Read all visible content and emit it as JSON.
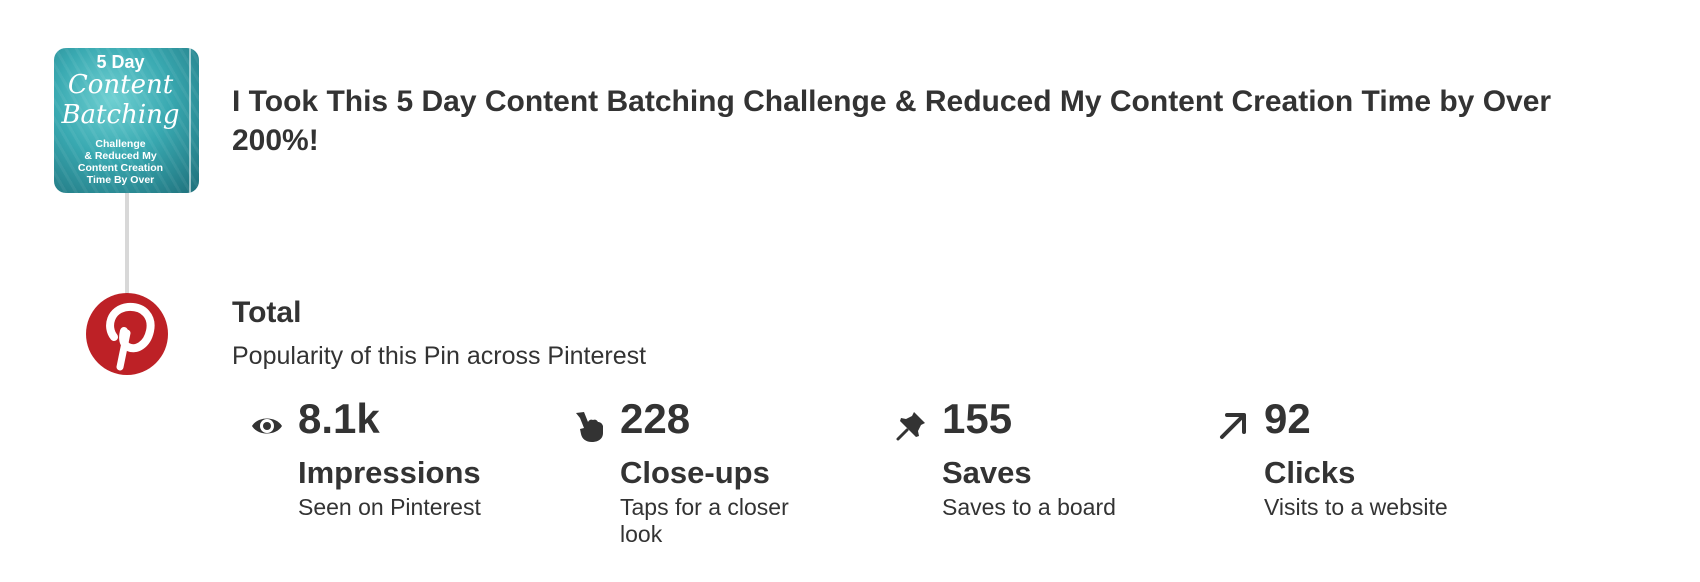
{
  "pin": {
    "title": "I Took This 5 Day Content Batching Challenge & Reduced My Content Creation Time by Over 200%!",
    "thumbnail": {
      "line1": "5 Day",
      "line2": "Content Batching",
      "line3": "Challenge\n& Reduced My\nContent Creation\nTime By Over"
    }
  },
  "logo_icon": "pinterest-logo",
  "brand_color": "#bd2126",
  "total": {
    "title": "Total",
    "subtitle": "Popularity of this Pin across Pinterest"
  },
  "stats": [
    {
      "icon": "eye-icon",
      "value": "8.1k",
      "label": "Impressions",
      "description": "Seen on Pinterest"
    },
    {
      "icon": "hand-pointer-icon",
      "value": "228",
      "label": "Close-ups",
      "description": "Taps for a closer look"
    },
    {
      "icon": "pin-icon",
      "value": "155",
      "label": "Saves",
      "description": "Saves to a board"
    },
    {
      "icon": "arrow-up-right-icon",
      "value": "92",
      "label": "Clicks",
      "description": "Visits to a website"
    }
  ]
}
